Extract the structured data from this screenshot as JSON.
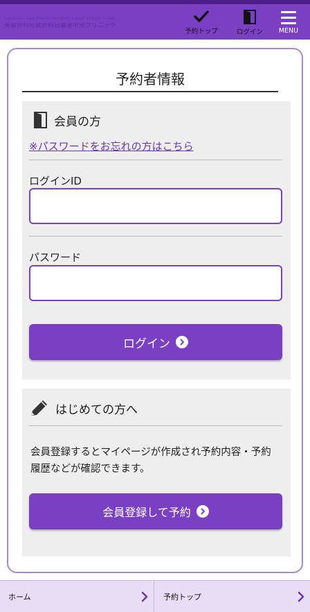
{
  "header": {
    "logo_sub": "Cosmetic and Plastic Surgery  Clinic  Dental Clinic",
    "logo_main": "美容外科形成外科日暮里中央クリニック",
    "nav_top_label": "予約トップ",
    "nav_login_label": "ログイン",
    "menu_label": "MENU"
  },
  "page": {
    "title": "予約者情報"
  },
  "member": {
    "heading": "会員の方",
    "forgot_link": "※パスワードをお忘れの方はこちら",
    "login_id_label": "ログインID",
    "login_id_value": "",
    "password_label": "パスワード",
    "password_value": "",
    "login_button": "ログイン"
  },
  "newcomer": {
    "heading": "はじめての方へ",
    "description": "会員登録するとマイページが作成され予約内容・予約履歴などが確認できます。",
    "register_button": "会員登録して予約"
  },
  "footer_nav": {
    "home_label": "ホーム",
    "top_label": "予約トップ"
  },
  "colors": {
    "brand_purple": "#7b3fc4",
    "header_dark": "#4d1e8a",
    "footer_bg": "#e9dcf5",
    "panel_bg": "#eeeeee"
  }
}
